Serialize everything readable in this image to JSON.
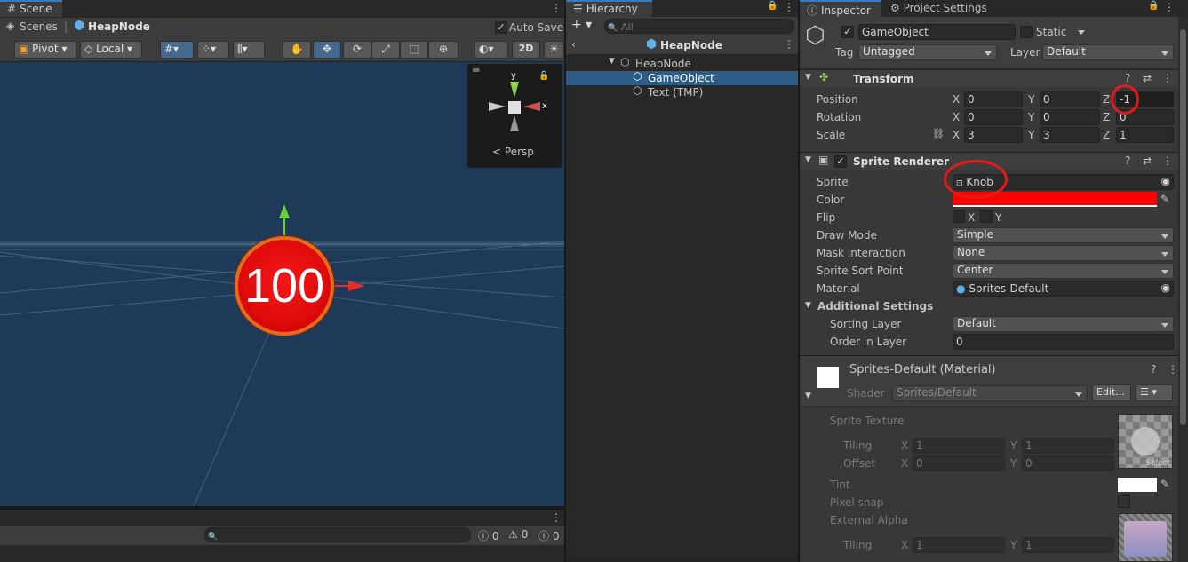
{
  "scene": {
    "tab_label": "Scene",
    "breadcrumb_root": "Scenes",
    "breadcrumb_sep": "|",
    "breadcrumb_current": "HeapNode",
    "auto_save_label": "Auto Save",
    "toolbar": {
      "pivot_label": "Pivot",
      "local_label": "Local",
      "two_d_label": "2D"
    },
    "gizmo": {
      "axis_y": "y",
      "axis_x": "x",
      "persp_label": "Persp"
    },
    "node_value": "100",
    "console": {
      "error_count": "0",
      "warning_count": "0",
      "info_count": "0"
    }
  },
  "hierarchy": {
    "tab_label": "Hierarchy",
    "search_placeholder": "All",
    "scene_title": "HeapNode",
    "items": [
      {
        "label": "HeapNode"
      },
      {
        "label": "GameObject"
      },
      {
        "label": "Text (TMP)"
      }
    ]
  },
  "inspector": {
    "tab_label": "Inspector",
    "project_settings_tab": "Project Settings",
    "object_name": "GameObject",
    "static_label": "Static",
    "tag_label": "Tag",
    "tag_value": "Untagged",
    "layer_label": "Layer",
    "layer_value": "Default",
    "transform": {
      "title": "Transform",
      "position_label": "Position",
      "rotation_label": "Rotation",
      "scale_label": "Scale",
      "x_label": "X",
      "y_label": "Y",
      "z_label": "Z",
      "position": {
        "x": "0",
        "y": "0",
        "z": "-1"
      },
      "rotation": {
        "x": "0",
        "y": "0",
        "z": "0"
      },
      "scale": {
        "x": "3",
        "y": "3",
        "z": "1"
      }
    },
    "sprite_renderer": {
      "title": "Sprite Renderer",
      "sprite_label": "Sprite",
      "sprite_value": "Knob",
      "color_label": "Color",
      "color_value": "#ff0000",
      "flip_label": "Flip",
      "flip_x": "X",
      "flip_y": "Y",
      "draw_mode_label": "Draw Mode",
      "draw_mode_value": "Simple",
      "mask_label": "Mask Interaction",
      "mask_value": "None",
      "sort_point_label": "Sprite Sort Point",
      "sort_point_value": "Center",
      "material_label": "Material",
      "material_value": "Sprites-Default",
      "additional_label": "Additional Settings",
      "sorting_layer_label": "Sorting Layer",
      "sorting_layer_value": "Default",
      "order_label": "Order in Layer",
      "order_value": "0"
    },
    "material": {
      "title": "Sprites-Default (Material)",
      "shader_label": "Shader",
      "shader_value": "Sprites/Default",
      "edit_label": "Edit...",
      "sprite_texture_label": "Sprite Texture",
      "tiling_label": "Tiling",
      "offset_label": "Offset",
      "tiling_x": "1",
      "tiling_y": "1",
      "offset_x": "0",
      "offset_y": "0",
      "select_label": "Select",
      "tint_label": "Tint",
      "pixel_snap_label": "Pixel snap",
      "external_alpha_label": "External Alpha",
      "tiling2_x": "1",
      "tiling2_y": "1"
    }
  },
  "colors": {
    "accent": "#3a79bb",
    "selection": "#2c5d87",
    "scene_bg": "#1f3a58",
    "annotation": "#e41a1a"
  }
}
